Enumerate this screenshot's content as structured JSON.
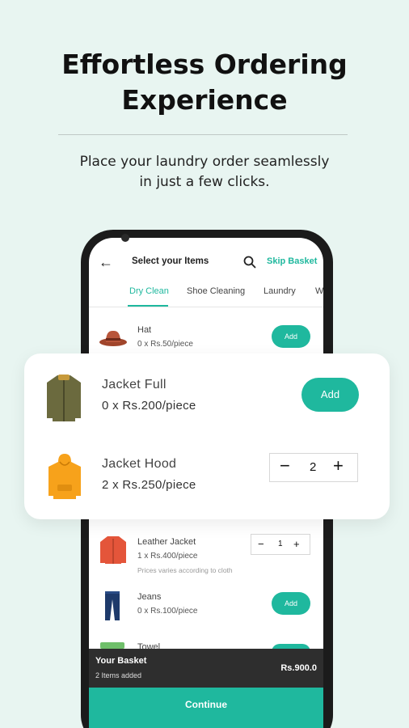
{
  "promo": {
    "headline_line1": "Effortless Ordering",
    "headline_line2": "Experience",
    "subhead_line1": "Place your laundry order seamlessly",
    "subhead_line2": "in just a few clicks."
  },
  "appbar": {
    "title": "Select your Items",
    "skip_label": "Skip Basket"
  },
  "tabs": [
    {
      "label": "Dry Clean",
      "active": true
    },
    {
      "label": "Shoe Cleaning",
      "active": false
    },
    {
      "label": "Laundry",
      "active": false
    },
    {
      "label": "W",
      "active": false
    }
  ],
  "items": [
    {
      "name": "Hat",
      "price": "0 x Rs.50/piece",
      "action": "Add"
    },
    {
      "name": "Leather Jacket",
      "price": "1 x Rs.400/piece",
      "note": "Prices varies according to cloth",
      "qty": "1"
    },
    {
      "name": "Jeans",
      "price": "0 x Rs.100/piece",
      "action": "Add"
    },
    {
      "name": "Towel"
    }
  ],
  "featured": [
    {
      "name": "Jacket Full",
      "price": "0 x Rs.200/piece",
      "action": "Add"
    },
    {
      "name": "Jacket Hood",
      "price": "2 x Rs.250/piece",
      "qty": "2"
    }
  ],
  "stepper": {
    "minus": "−",
    "plus": "+"
  },
  "basket": {
    "title": "Your Basket",
    "subtitle": "2 Items added",
    "total": "Rs.900.0",
    "continue_label": "Continue"
  },
  "colors": {
    "accent": "#1fb89e",
    "background": "#e8f5f1",
    "basket_bar": "#2e2e2e"
  }
}
